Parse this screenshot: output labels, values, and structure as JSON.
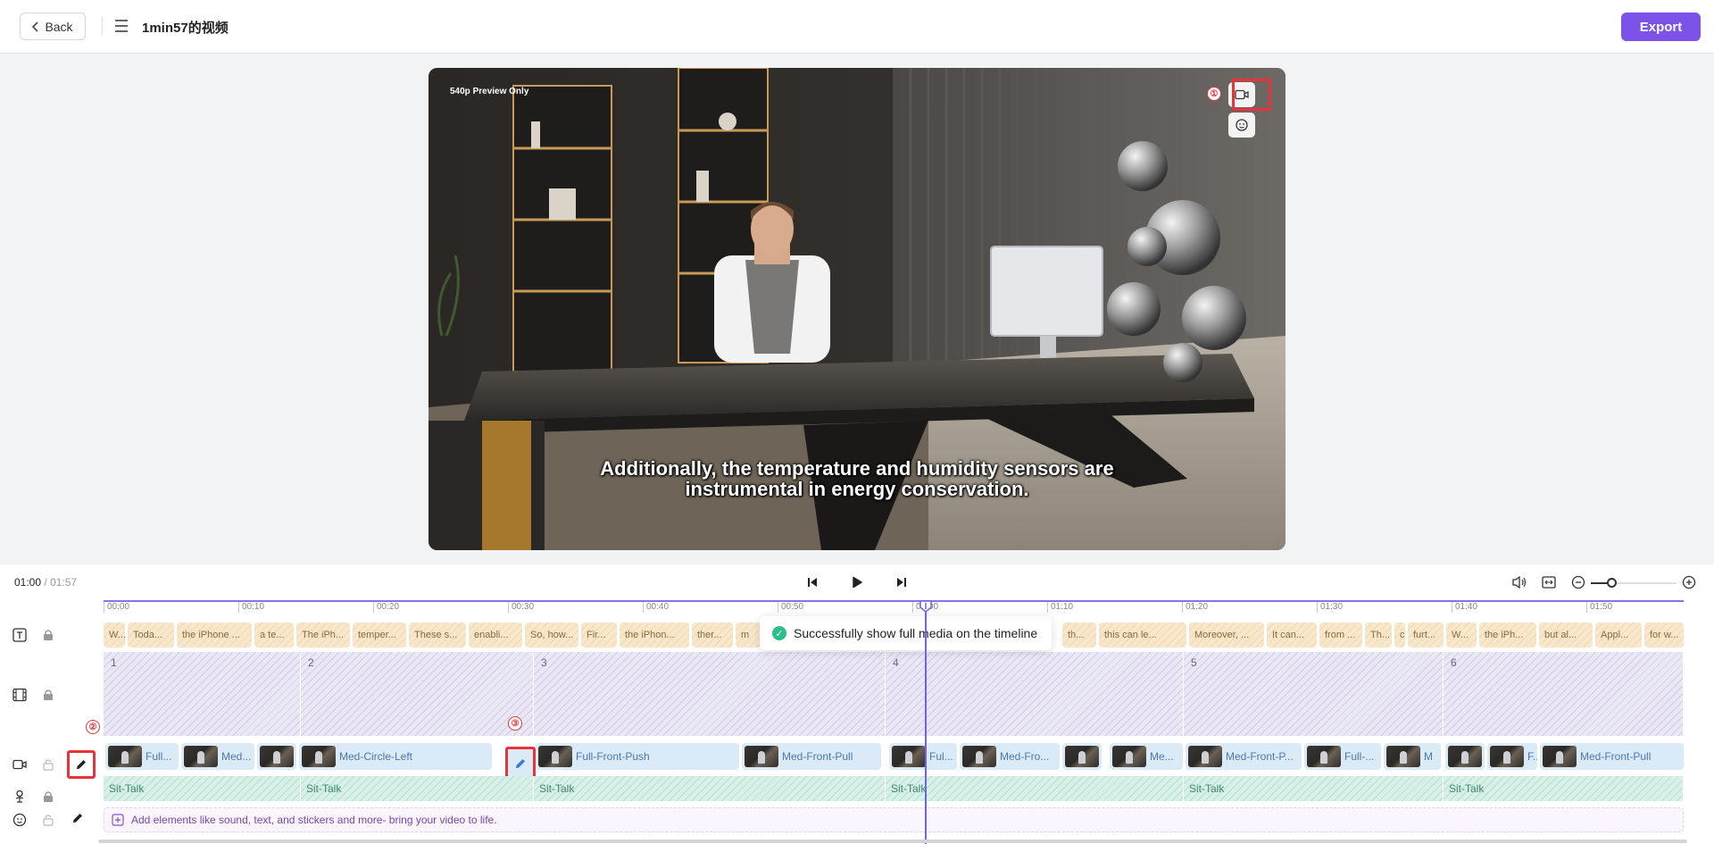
{
  "header": {
    "back_label": "Back",
    "project_title": "1min57的视频",
    "export_label": "Export"
  },
  "preview": {
    "label": "540p Preview Only",
    "subtitle_line1": "Additionally, the temperature and humidity sensors are",
    "subtitle_line2": "instrumental in energy conservation.",
    "controls": [
      "camera-icon",
      "avatar-face-icon"
    ]
  },
  "annotations": {
    "badge_1": "①",
    "badge_2": "②",
    "badge_3": "③",
    "highlight_color": "#e8333a"
  },
  "timeline": {
    "current_time": "01:00",
    "separator": "/",
    "total_time": "01:57",
    "ruler_ticks": [
      "00:00",
      "00:10",
      "00:20",
      "00:30",
      "00:40",
      "00:50",
      "01:00",
      "01:10",
      "01:20",
      "01:30",
      "01:40",
      "01:50"
    ],
    "text_clips": [
      "W...",
      "Toda...",
      "the iPhone ...",
      "a te...",
      "The iPh...",
      "temper...",
      "These s...",
      "enabli...",
      "So, how...",
      "Fir...",
      "the iPhon...",
      "ther...",
      "m",
      "th...",
      "this can le...",
      "Moreover, ...",
      "It can...",
      "from ...",
      "Th...",
      "c",
      "furt...",
      "W...",
      "the iPh...",
      "but al...",
      "Appl...",
      "for w..."
    ],
    "scenes": [
      "1",
      "2",
      "3",
      "4",
      "5",
      "6"
    ],
    "camera_clips": [
      "Full...",
      "Med...",
      "",
      "Med-Circle-Left",
      "Full-Front-Push",
      "Med-Front-Pull",
      "Ful...",
      "Med-Fro...",
      "",
      "Me...",
      "Med-Front-P...",
      "Full-...",
      "M",
      "",
      "F...",
      "Med-Front-Pull"
    ],
    "action_clips": [
      "Sit-Talk",
      "Sit-Talk",
      "Sit-Talk",
      "Sit-Talk",
      "Sit-Talk",
      "Sit-Talk"
    ],
    "elements_hint": "Add elements like sound, text, and stickers and more- bring your video to life."
  },
  "toast": {
    "message": "Successfully show full media on the timeline"
  },
  "colors": {
    "accent": "#7c52e8",
    "playhead": "#6f63e8",
    "success": "#2bbd8a"
  }
}
